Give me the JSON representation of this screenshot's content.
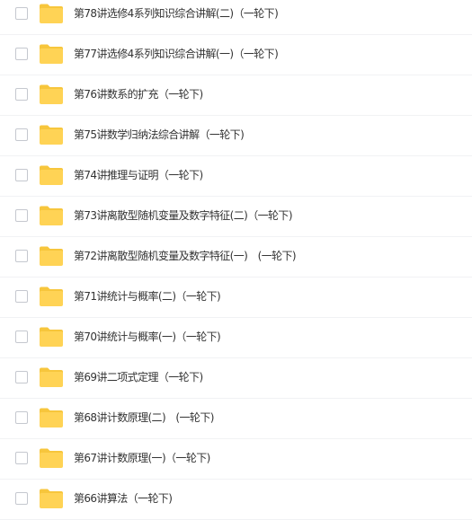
{
  "colors": {
    "folder_body": "#ffd355",
    "folder_tab": "#f7c63c",
    "text": "#333333",
    "divider": "#f1f2f4"
  },
  "files": [
    {
      "name": "第78讲选修4系列知识综合讲解(二)（一轮下)",
      "icon": "folder-icon"
    },
    {
      "name": "第77讲选修4系列知识综合讲解(一)（一轮下)",
      "icon": "folder-icon"
    },
    {
      "name": "第76讲数系的扩充（一轮下)",
      "icon": "folder-icon"
    },
    {
      "name": "第75讲数学归纳法综合讲解（一轮下)",
      "icon": "folder-icon"
    },
    {
      "name": "第74讲推理与证明（一轮下)",
      "icon": "folder-icon"
    },
    {
      "name": "第73讲离散型随机变量及数字特征(二)（一轮下)",
      "icon": "folder-icon"
    },
    {
      "name": "第72讲离散型随机变量及数字特征(一)　(一轮下)",
      "icon": "folder-icon"
    },
    {
      "name": "第71讲统计与概率(二)（一轮下)",
      "icon": "folder-icon"
    },
    {
      "name": "第70讲统计与概率(一)（一轮下)",
      "icon": "folder-icon"
    },
    {
      "name": "第69讲二项式定理（一轮下)",
      "icon": "folder-icon"
    },
    {
      "name": "第68讲计数原理(二)　(一轮下)",
      "icon": "folder-icon"
    },
    {
      "name": "第67讲计数原理(一)（一轮下)",
      "icon": "folder-icon"
    },
    {
      "name": "第66讲算法（一轮下)",
      "icon": "folder-icon"
    }
  ]
}
